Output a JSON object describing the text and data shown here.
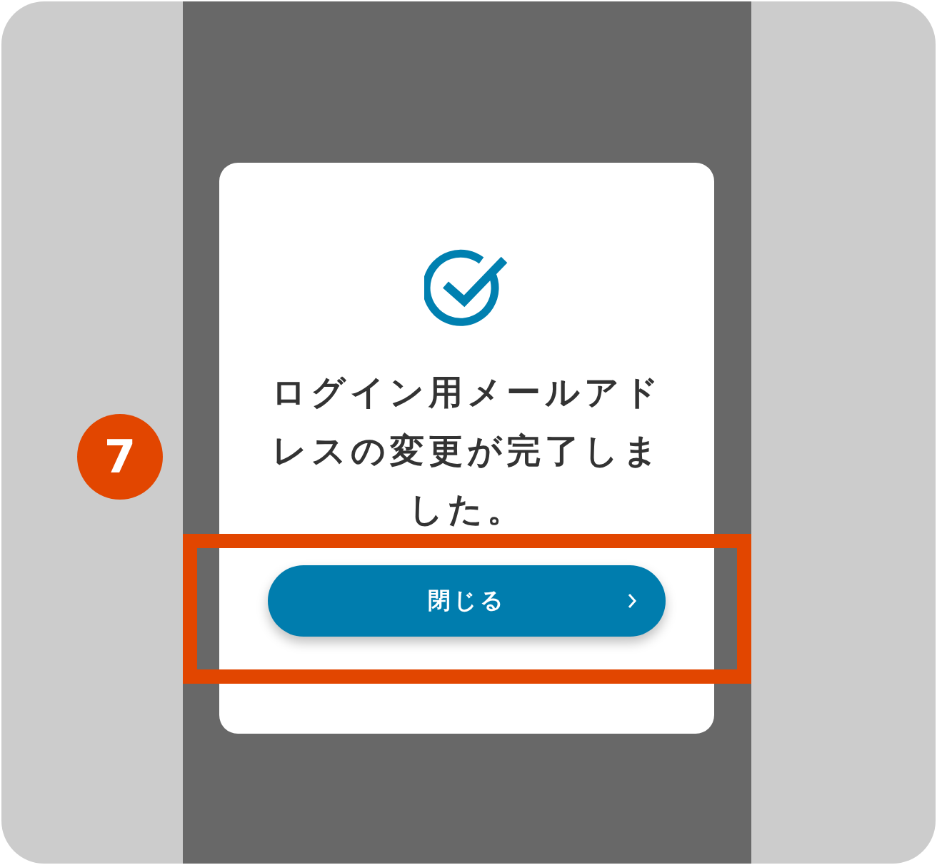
{
  "step_badge": "7",
  "dialog": {
    "message": "ログイン用メールアドレスの変更が完了しました。",
    "button": {
      "label": "閉じる"
    }
  }
}
